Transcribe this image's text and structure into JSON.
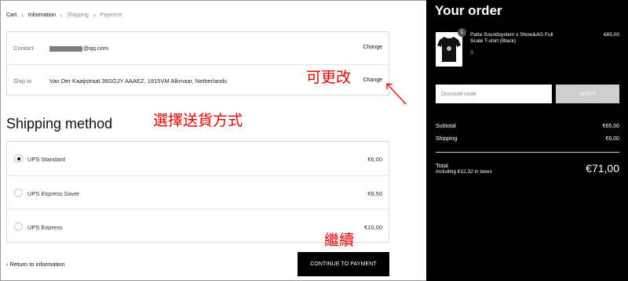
{
  "breadcrumb": {
    "items": [
      "Cart",
      "Information",
      "Shipping",
      "Payment"
    ]
  },
  "info": {
    "contact_label": "Contact",
    "contact_value": "@qq.com",
    "ship_label": "Ship to",
    "ship_value": "Van Der Kaaijstraat 38SGJY AAAEZ, 1815VM Alkmaar, Netherlands",
    "change_label": "Change"
  },
  "shipping": {
    "title": "Shipping method",
    "methods": [
      {
        "name": "UPS Standard",
        "price": "€6,00",
        "selected": true
      },
      {
        "name": "UPS Express Saver",
        "price": "€8,50",
        "selected": false
      },
      {
        "name": "UPS Express",
        "price": "€10,00",
        "selected": false
      }
    ]
  },
  "nav": {
    "back_label": "Return to information",
    "continue_label": "CONTINUE TO PAYMENT"
  },
  "annotations": {
    "change": "可更改",
    "shipping": "選擇送貨方式",
    "continue": "繼續"
  },
  "order": {
    "title": "Your order",
    "product": {
      "name": "Patta Soundsystem x Show&AG Full Scale T-shirt (Black)",
      "variant": "S",
      "price": "€65,00",
      "quantity": "1"
    },
    "discount_placeholder": "Discount code",
    "apply_label": "APPLY",
    "subtotal_label": "Subtotal",
    "subtotal_value": "€65,00",
    "shipping_label": "Shipping",
    "shipping_value": "€6,00",
    "total_label": "Total",
    "tax_note": "Including €12,32 in taxes",
    "total_value": "€71,00"
  },
  "colors": {
    "annotation": "#e00000",
    "panel_bg": "#000000",
    "apply_bg": "#cfcfcf"
  }
}
